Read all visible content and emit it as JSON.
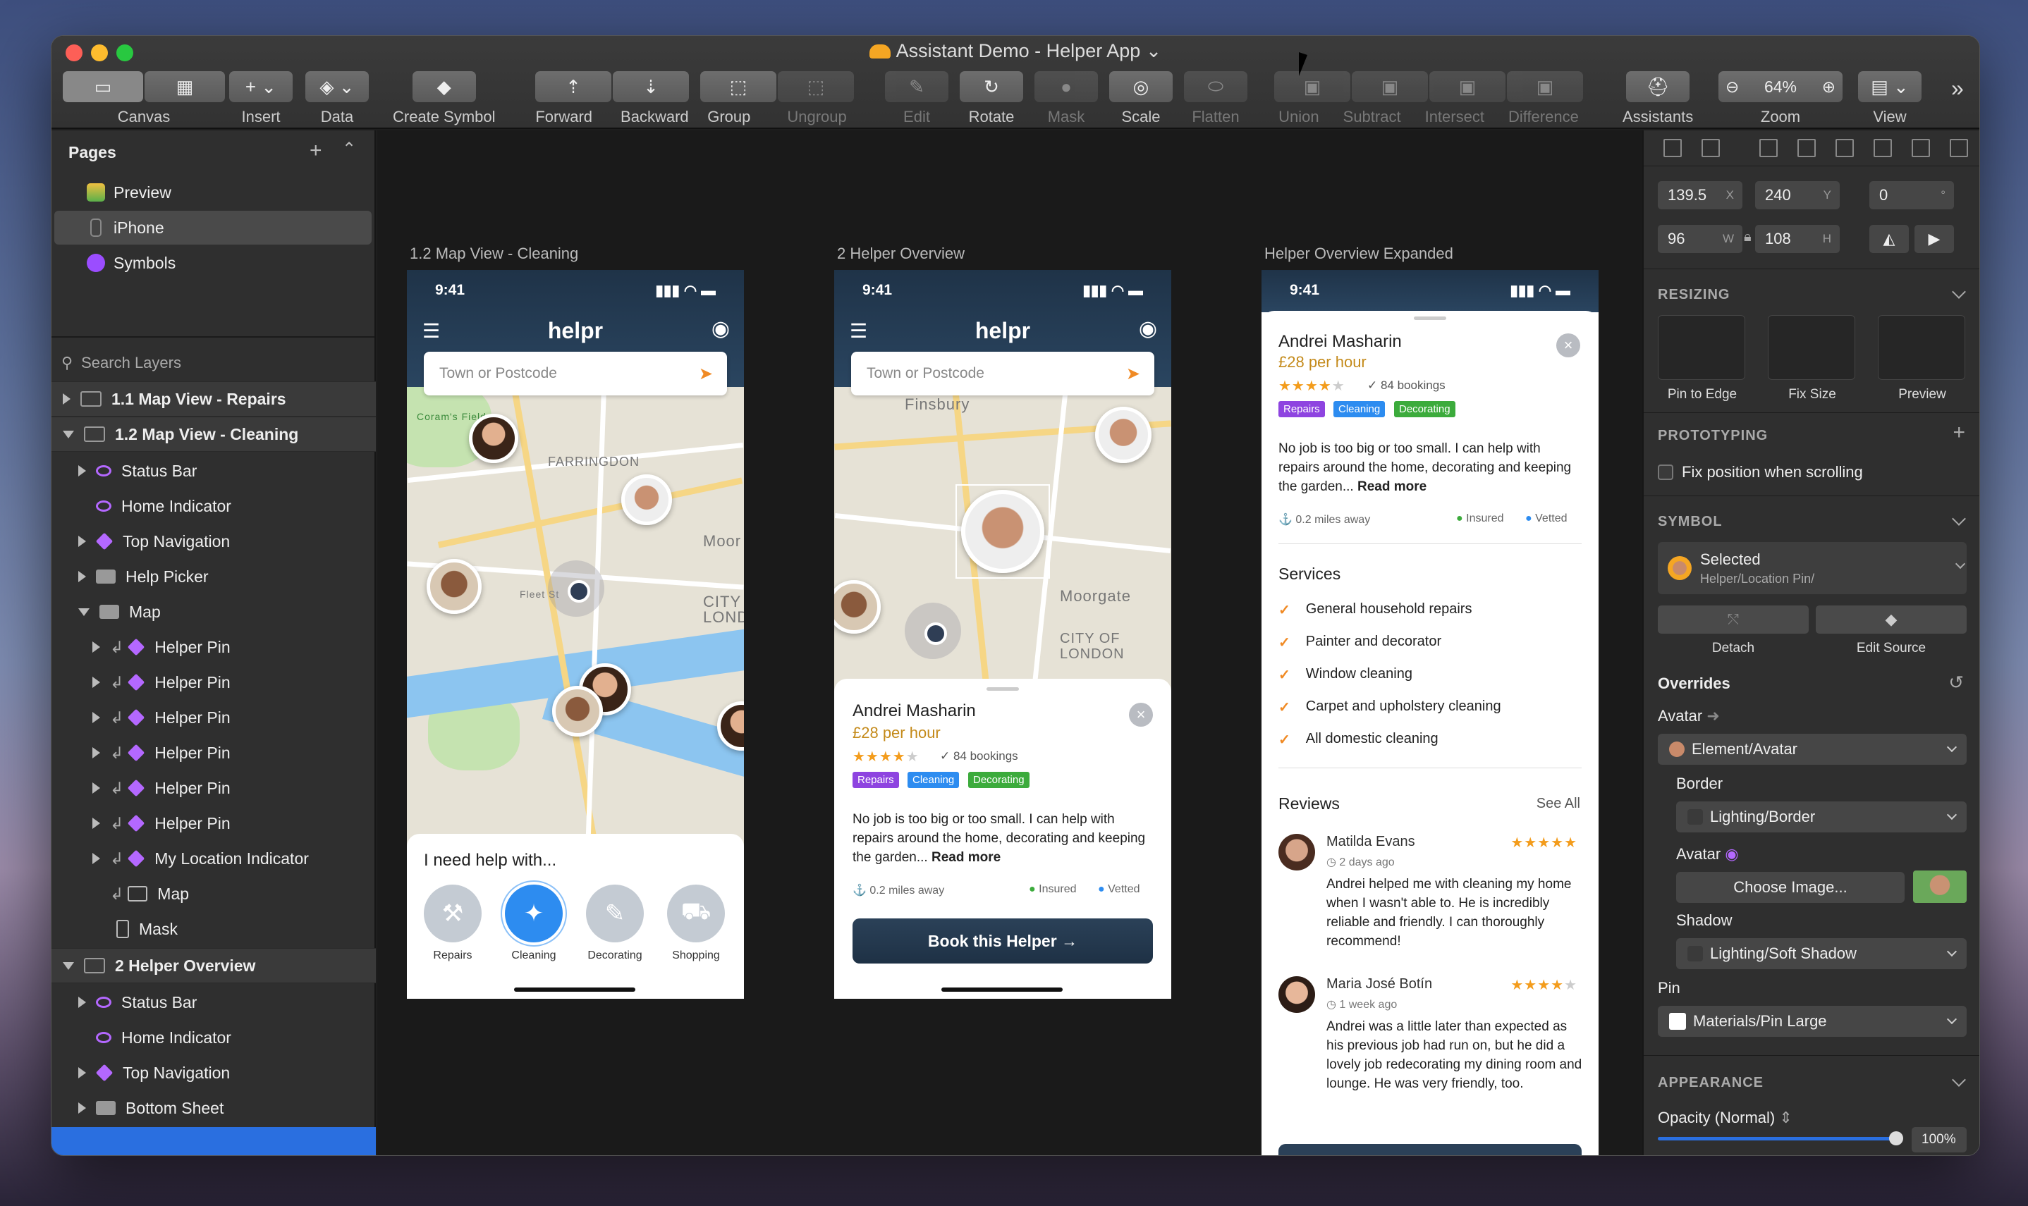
{
  "window": {
    "title": "Assistant Demo - Helper App"
  },
  "toolbar": {
    "canvas": "Canvas",
    "insert": "Insert",
    "data": "Data",
    "create_symbol": "Create Symbol",
    "forward": "Forward",
    "backward": "Backward",
    "group": "Group",
    "ungroup": "Ungroup",
    "edit": "Edit",
    "rotate": "Rotate",
    "mask": "Mask",
    "scale": "Scale",
    "flatten": "Flatten",
    "union": "Union",
    "subtract": "Subtract",
    "intersect": "Intersect",
    "difference": "Difference",
    "assistants": "Assistants",
    "zoom": "Zoom",
    "zoom_value": "64%",
    "view": "View"
  },
  "pages": {
    "header": "Pages",
    "items": [
      "Preview",
      "iPhone",
      "Symbols"
    ]
  },
  "layers": {
    "search_placeholder": "Search Layers",
    "items": [
      "1.1 Map View - Repairs",
      "1.2 Map View - Cleaning",
      "Status Bar",
      "Home Indicator",
      "Top Navigation",
      "Help Picker",
      "Map",
      "Helper Pin",
      "Helper Pin",
      "Helper Pin",
      "Helper Pin",
      "Helper Pin",
      "Helper Pin",
      "My Location Indicator",
      "Map",
      "Mask",
      "2 Helper Overview",
      "Status Bar",
      "Home Indicator",
      "Top Navigation",
      "Bottom Sheet"
    ]
  },
  "artboards": {
    "a1": "1.2 Map View - Cleaning",
    "a2": "2 Helper Overview",
    "a3": "Helper Overview Expanded"
  },
  "phone": {
    "time": "9:41",
    "brand": "helpr",
    "search_placeholder": "Town or Postcode",
    "need_help": "I need help with...",
    "categories": [
      "Repairs",
      "Cleaning",
      "Decorating",
      "Shopping"
    ]
  },
  "map_labels": {
    "farringdon": "FARRINGDON",
    "moor": "Moor",
    "city": "CITY",
    "lond": "LOND",
    "finsbury": "Finsbury",
    "moorgate": "Moorgate",
    "city_of": "CITY OF",
    "london": "LONDON",
    "fleet": "Fleet St",
    "coram": "Coram's Fields"
  },
  "helper": {
    "name": "Andrei Masharin",
    "rate": "£28 per hour",
    "bookings": "84 bookings",
    "tags": [
      "Repairs",
      "Cleaning",
      "Decorating"
    ],
    "desc": "No job is too big or too small. I can help with repairs around the home, decorating and keeping the garden...",
    "read_more": "Read more",
    "distance": "0.2 miles away",
    "insured": "Insured",
    "vetted": "Vetted",
    "book": "Book this Helper →"
  },
  "services": {
    "title": "Services",
    "items": [
      "General household repairs",
      "Painter and decorator",
      "Window cleaning",
      "Carpet and upholstery cleaning",
      "All domestic cleaning"
    ]
  },
  "reviews": {
    "title": "Reviews",
    "see_all": "See All",
    "items": [
      {
        "name": "Matilda Evans",
        "time": "2 days ago",
        "text": "Andrei helped me with cleaning my home when I wasn't able to. He is incredibly reliable and friendly. I can thoroughly recommend!",
        "stars": 5
      },
      {
        "name": "Maria José Botín",
        "time": "1 week ago",
        "text": "Andrei was a little later than expected as his previous job had run on, but he did a lovely job redecorating my dining room and lounge. He was very friendly, too.",
        "stars": 4
      }
    ]
  },
  "inspector": {
    "x": "139.5",
    "y": "240",
    "rot": "0",
    "w": "96",
    "h": "108",
    "x_sfx": "X",
    "y_sfx": "Y",
    "w_sfx": "W",
    "h_sfx": "H",
    "deg_sfx": "°",
    "resizing": "RESIZING",
    "pin_to_edge": "Pin to Edge",
    "fix_size": "Fix Size",
    "preview": "Preview",
    "prototyping": "PROTOTYPING",
    "fix_scroll": "Fix position when scrolling",
    "symbol": "SYMBOL",
    "selected": "Selected",
    "selected_path": "Helper/Location Pin/",
    "detach": "Detach",
    "edit_source": "Edit Source",
    "overrides": "Overrides",
    "avatar": "Avatar",
    "avatar_value": "Element/Avatar",
    "border": "Border",
    "border_value": "Lighting/Border",
    "avatar2": "Avatar",
    "choose_image": "Choose Image...",
    "shadow": "Shadow",
    "shadow_value": "Lighting/Soft Shadow",
    "pin": "Pin",
    "pin_value": "Materials/Pin Large",
    "appearance": "APPEARANCE",
    "opacity": "Opacity (Normal)",
    "opacity_value": "100%"
  },
  "colors": {
    "accent": "#2a6fe0",
    "repairs": "#8e44e0",
    "cleaning": "#2d8cf0",
    "decorating": "#3cab3c",
    "star": "#f39c1c",
    "navy": "#1f3348"
  }
}
